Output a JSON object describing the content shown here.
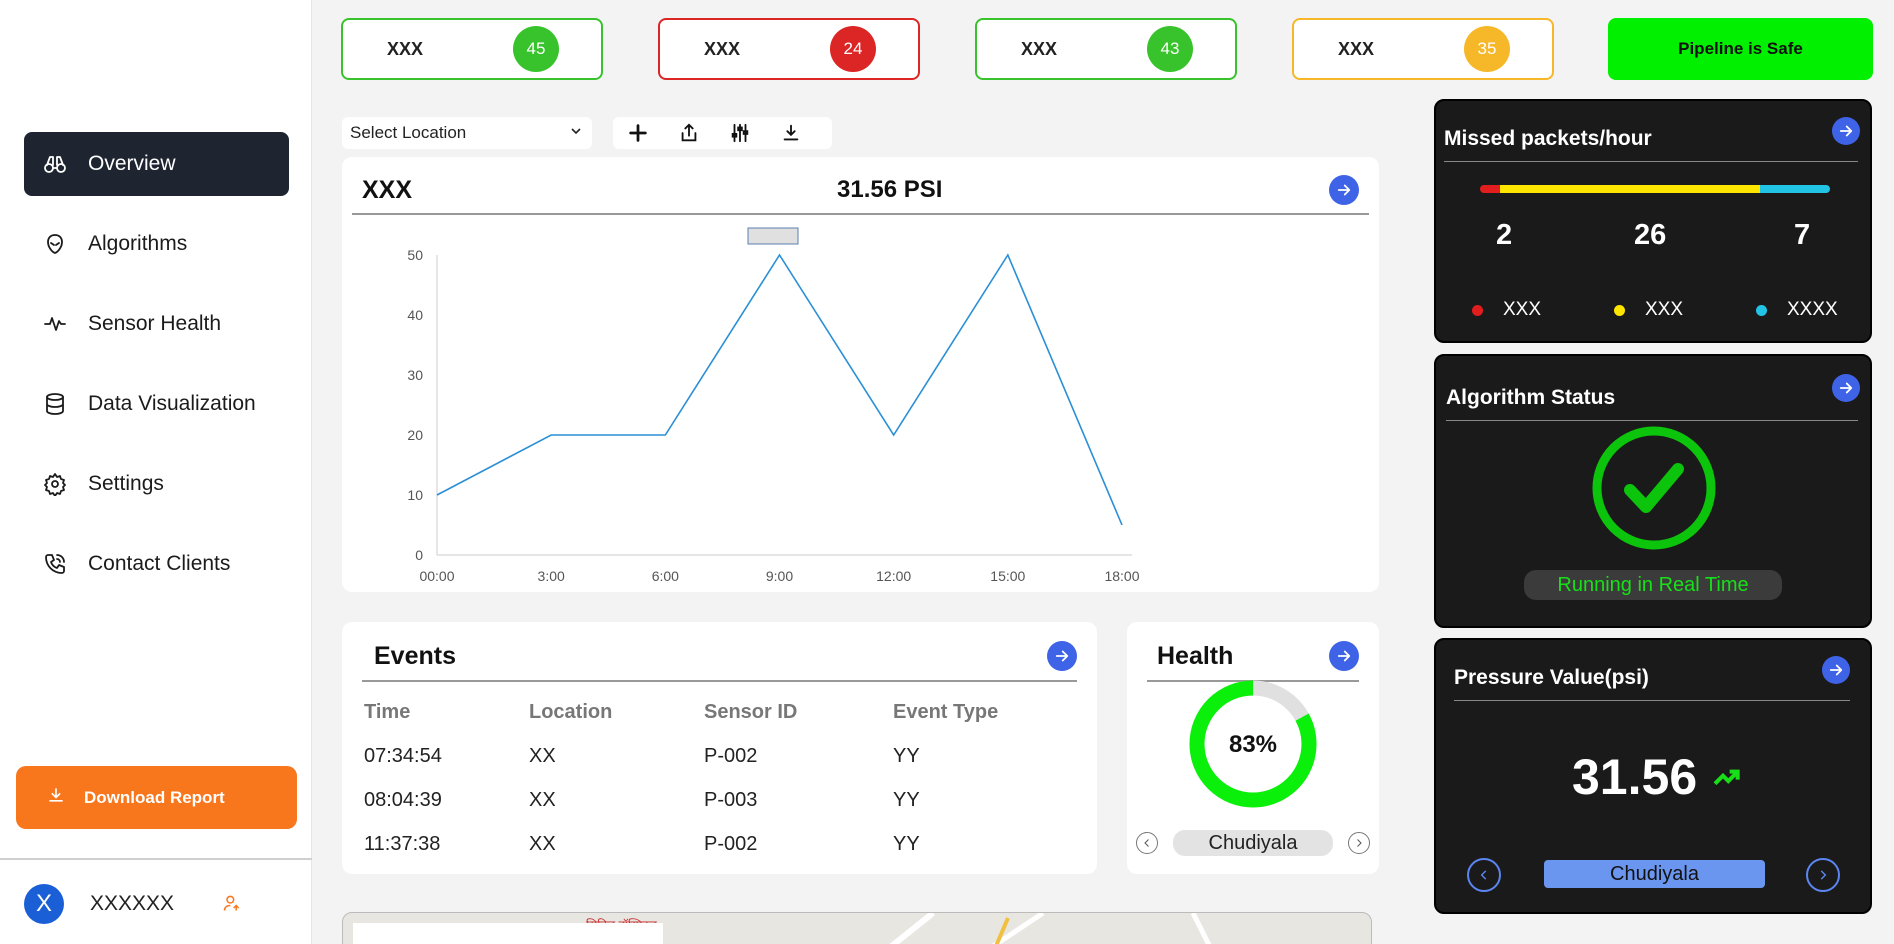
{
  "sidebar": {
    "items": [
      {
        "label": "Overview",
        "icon": "binoculars-icon"
      },
      {
        "label": "Algorithms",
        "icon": "alien-icon"
      },
      {
        "label": "Sensor Health",
        "icon": "pulse-icon"
      },
      {
        "label": "Data Visualization",
        "icon": "database-icon"
      },
      {
        "label": "Settings",
        "icon": "gear-icon"
      },
      {
        "label": "Contact Clients",
        "icon": "phone-icon"
      }
    ],
    "download_label": "Download Report",
    "user": {
      "initial": "X",
      "name": "XXXXXX"
    }
  },
  "stats": [
    {
      "label": "XXX",
      "value": "45",
      "color": "#38c32c"
    },
    {
      "label": "XXX",
      "value": "24",
      "color": "#dc2626"
    },
    {
      "label": "XXX",
      "value": "43",
      "color": "#38c32c"
    },
    {
      "label": "XXX",
      "value": "35",
      "color": "#f6b829"
    }
  ],
  "status_banner": "Pipeline is Safe",
  "location_select": {
    "selected": "Select Location"
  },
  "chart_card": {
    "title": "XXX",
    "value": "31.56 PSI"
  },
  "chart_data": {
    "type": "line",
    "x": [
      "00:00",
      "3:00",
      "6:00",
      "9:00",
      "12:00",
      "15:00",
      "18:00"
    ],
    "values": [
      10,
      20,
      20,
      50,
      20,
      50,
      5
    ],
    "yticks": [
      0,
      10,
      20,
      30,
      40,
      50
    ],
    "ylim": [
      0,
      50
    ],
    "color": "#2a8fd6"
  },
  "events": {
    "title": "Events",
    "columns": [
      "Time",
      "Location",
      "Sensor ID",
      "Event Type"
    ],
    "rows": [
      [
        "07:34:54",
        "XX",
        "P-002",
        "YY"
      ],
      [
        "08:04:39",
        "XX",
        "P-003",
        "YY"
      ],
      [
        "11:37:38",
        "XX",
        "P-002",
        "YY"
      ]
    ]
  },
  "health": {
    "title": "Health",
    "percent_label": "83%",
    "percent": 83,
    "location": "Chudiyala"
  },
  "missed_packets": {
    "title": "Missed packets/hour",
    "values": [
      "2",
      "26",
      "7"
    ],
    "legend": [
      "XXX",
      "XXX",
      "XXXX"
    ],
    "colors": [
      "#e11d1d",
      "#ffe600",
      "#22c4e6"
    ]
  },
  "algorithm_status": {
    "title": "Algorithm Status",
    "status": "Running in Real Time"
  },
  "pressure": {
    "title": "Pressure Value(psi)",
    "value": "31.56",
    "location": "Chudiyala"
  },
  "map": {
    "label": "सिविल हॉस्पिटल"
  }
}
